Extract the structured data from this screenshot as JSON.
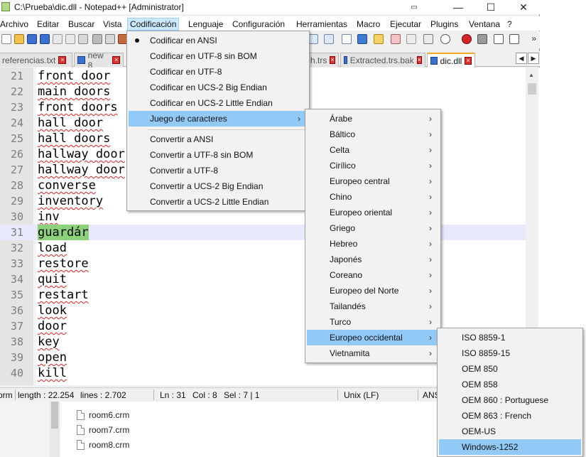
{
  "window": {
    "title": "C:\\Prueba\\dic.dll - Notepad++ [Administrator]",
    "minimize": "—",
    "maximize": "☐",
    "close": "✕"
  },
  "menubar": [
    "Archivo",
    "Editar",
    "Buscar",
    "Vista",
    "Codificación",
    "Lenguaje",
    "Configuración",
    "Herramientas",
    "Macro",
    "Ejecutar",
    "Plugins",
    "Ventana",
    "?"
  ],
  "toolbar": {
    "overflow": "»"
  },
  "tabs": [
    "referencias.txt",
    "new 8",
    "h.trs",
    "Extracted.trs.bak",
    "dic.dll"
  ],
  "tab_nav": {
    "left": "◀",
    "right": "▶"
  },
  "editor": {
    "lines": [
      {
        "n": "21",
        "t": "front door"
      },
      {
        "n": "22",
        "t": "main doors"
      },
      {
        "n": "23",
        "t": "front doors"
      },
      {
        "n": "24",
        "t": "hall door"
      },
      {
        "n": "25",
        "t": "hall doors"
      },
      {
        "n": "26",
        "t": "hallway door"
      },
      {
        "n": "27",
        "t": "hallway door"
      },
      {
        "n": "28",
        "t": "converse"
      },
      {
        "n": "29",
        "t": "inventory"
      },
      {
        "n": "30",
        "t": "inv"
      },
      {
        "n": "31",
        "t": "guardár"
      },
      {
        "n": "32",
        "t": "load"
      },
      {
        "n": "33",
        "t": "restore"
      },
      {
        "n": "34",
        "t": "quit"
      },
      {
        "n": "35",
        "t": "restart"
      },
      {
        "n": "36",
        "t": "look"
      },
      {
        "n": "37",
        "t": "door"
      },
      {
        "n": "38",
        "t": "key"
      },
      {
        "n": "39",
        "t": "open"
      },
      {
        "n": "40",
        "t": "kill"
      }
    ],
    "scroll_up": "▲"
  },
  "status": {
    "type": "orm",
    "length": "length : 22.254",
    "lines": "lines : 2.702",
    "ln": "Ln : 31",
    "col": "Col : 8",
    "sel": "Sel : 7 | 1",
    "eol": "Unix (LF)",
    "encoding": "ANS"
  },
  "encoding_menu": {
    "items": [
      "Codificar en ANSI",
      "Codificar en UTF-8 sin BOM",
      "Codificar en UTF-8",
      "Codificar en UCS-2 Big Endian",
      "Codificar en UCS-2 Little Endian"
    ],
    "charset": "Juego de caracteres",
    "convert": [
      "Convertir a ANSI",
      "Convertir a UTF-8 sin BOM",
      "Convertir a UTF-8",
      "Convertir a UCS-2 Big Endian",
      "Convertir a UCS-2 Little Endian"
    ]
  },
  "charset_menu": [
    "Árabe",
    "Báltico",
    "Celta",
    "Cirílico",
    "Europeo central",
    "Chino",
    "Europeo oriental",
    "Griego",
    "Hebreo",
    "Japonés",
    "Coreano",
    "Europeo del Norte",
    "Tailandés",
    "Turco",
    "Europeo occidental",
    "Vietnamita"
  ],
  "western_menu": [
    "ISO 8859-1",
    "ISO 8859-15",
    "OEM 850",
    "OEM 858",
    "OEM 860 : Portuguese",
    "OEM 863 : French",
    "OEM-US",
    "Windows-1252"
  ],
  "submenu_arrow": "›",
  "background_files": [
    "room6.crm",
    "room7.crm",
    "room8.crm"
  ],
  "colors": {
    "menu_highlight": "#91c9f7",
    "current_line": "#e8e8ff",
    "selection": "#8cd27a",
    "active_tab_accent": "#f6a623"
  }
}
